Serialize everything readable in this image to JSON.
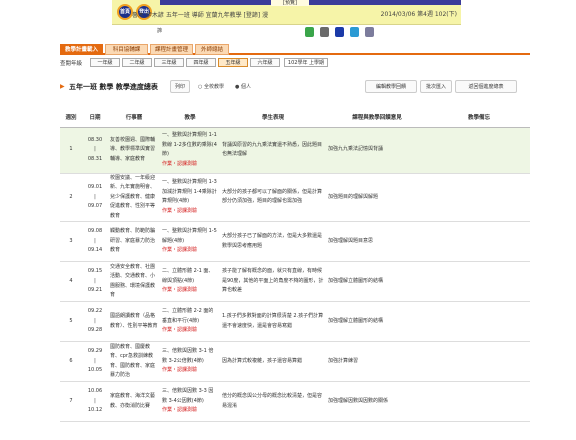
{
  "header": {
    "tag": "[預覽]",
    "btn1": "首頁",
    "btn2": "登出",
    "info": "魯木 伊木諺 五年一班 導師 宜蘭九年教學 [登諦] 漫",
    "date": "2014/03/06 第4週 102(下)",
    "subinfo": "諦"
  },
  "tabs": [
    "教學計畫載入",
    "科目協輔課",
    "課程計畫管理",
    "外師總結"
  ],
  "grade": {
    "label": "查閱年級",
    "buttons": [
      "一年級",
      "二年級",
      "三年級",
      "四年級",
      "五年級",
      "六年級"
    ],
    "active": 4,
    "year": "102學年 上學期"
  },
  "title": {
    "text": "五年一班 數學 教學進度總表",
    "print": "列印",
    "opt1": "全校教學",
    "opt2": "個人",
    "b1": "編輯教學回饋",
    "b2": "批次匯入",
    "b3": "返回個進度總表"
  },
  "columns": [
    "週別",
    "日期",
    "行事曆",
    "教學",
    "學生表現",
    "課程與教學回饋意見",
    "教學備忘"
  ],
  "rows": [
    {
      "week": "1",
      "d1": "08.30",
      "d2": "08.31",
      "cal": "友善校園週、國際輔導、教學標準與實習輔導、家庭教育",
      "teach": "一、整數與計算規則 1-1 數線 1-2多位數的乘除(4節)",
      "work": "作業・認課測驗",
      "perf": "背誦與原習的九九乘法實還不熟悉，因此題目也無法理解",
      "fb": "加強九九乘法記憶與背誦",
      "note": ""
    },
    {
      "week": "2",
      "d1": "09.01",
      "d2": "09.07",
      "cal": "校園安議、一年級迎新、九年實施明會、兒少保護教育、健康促進教育、性別平等教育",
      "teach": "一、整數與計算規則 1-3 加減計算規則 1-4乘除計算規則(4節)",
      "work": "作業・認課測驗",
      "perf": "大部分的孩子都可以了解面的關係，但是計算部分仍須加強，題目的理解也需加強",
      "fb": "加強題目的理解與解題",
      "note": ""
    },
    {
      "week": "3",
      "d1": "09.08",
      "d2": "09.14",
      "cal": "觸動教育、防範防騙研習、家庭暴力防治教育",
      "teach": "一、整數與計算規則 1-5 解題(4節)",
      "work": "作業・認課測驗",
      "perf": "大部分孩子已了解面的方法，但是大多數還是數學與思考應用題",
      "fb": "加強理解與題目意思",
      "note": ""
    },
    {
      "week": "4",
      "d1": "09.15",
      "d2": "09.21",
      "cal": "交通安全教育、社團活動、交通教育、小團服務、環境保護教育",
      "teach": "二、立體形體 2-1 面、線與頂點(4節)",
      "work": "作業・認課測驗",
      "perf": "孩子能了解有概念的面，就只有直線，有時候是90度，其他的平面上的角度不夠的圖形，計算也較差",
      "fb": "加強理解立體圖形的結構",
      "note": ""
    },
    {
      "week": "5",
      "d1": "09.22",
      "d2": "09.28",
      "cal": "國語朗讀教育（品格教育）、性別平等教育",
      "teach": "二、立體形體 2-2 面的垂直和平行(4節)",
      "work": "作業・認課測驗",
      "perf": "1.孩子們多數對面的計算很清楚 2.孩子們計算還不會速度快，還是會容易寫錯",
      "fb": "加強理解立體圖形的結構",
      "note": ""
    },
    {
      "week": "6",
      "d1": "09.29",
      "d2": "10.05",
      "cal": "國防教育、國慶教育、cpr急救訓練教育、國防教育、家庭暴力防治",
      "teach": "三、倍數與因數 3-1 倍數 3-2公倍數(4節)",
      "work": "作業・認課測驗",
      "perf": "因為計算式較複雜，孩子還容易算錯",
      "fb": "加強計算練習",
      "note": ""
    },
    {
      "week": "7",
      "d1": "10.06",
      "d2": "10.12",
      "cal": "家庭教育、海洋文藝教、亦衡消防比賽",
      "teach": "三、倍數與因數 3-3 因數 3-4公因數(4節)",
      "work": "作業・認課測驗",
      "perf": "倍分的概念與公分母的概念比較清楚，但是容易混淆",
      "fb": "加強理解因數與因數的關係",
      "note": ""
    }
  ]
}
